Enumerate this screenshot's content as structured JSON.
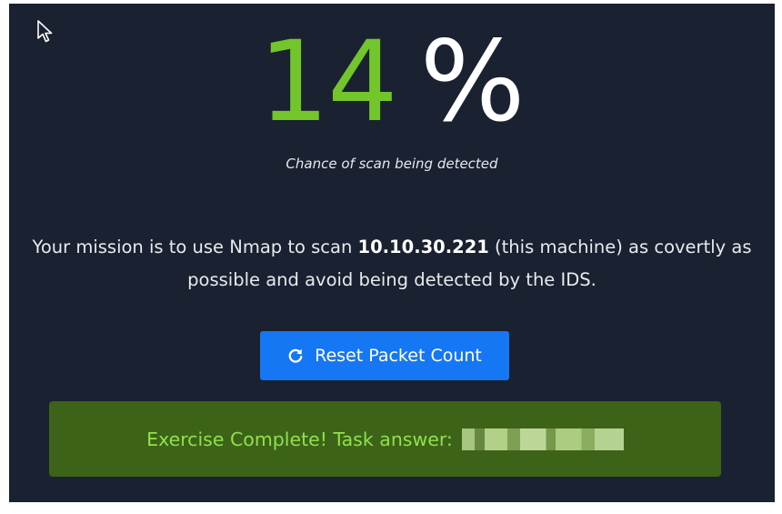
{
  "detection": {
    "value": "14",
    "unit": "%",
    "caption": "Chance of scan being detected"
  },
  "mission": {
    "text_before": "Your mission is to use Nmap to scan ",
    "ip": "10.10.30.221",
    "text_after": " (this machine) as covertly as possible and avoid being detected by the IDS."
  },
  "reset_button": {
    "icon": "refresh-icon",
    "label": "Reset Packet Count"
  },
  "result": {
    "label": "Exercise Complete! Task answer:"
  },
  "colors": {
    "background": "#1a2130",
    "percent_green": "#72c52a",
    "button_blue": "#1677f4",
    "success_bg": "#3d6319",
    "success_text": "#8fe24a"
  }
}
